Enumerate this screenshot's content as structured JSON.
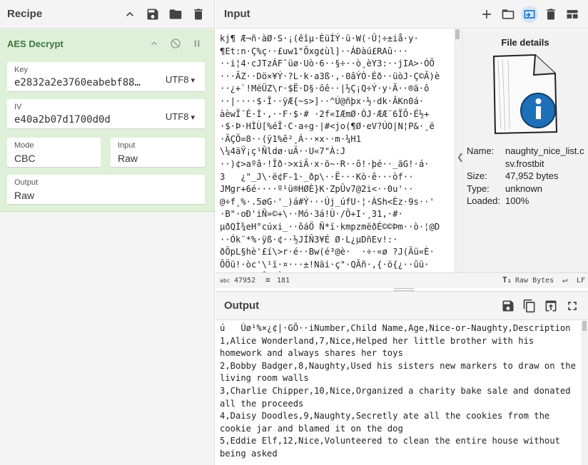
{
  "recipe": {
    "title": "Recipe",
    "operation": {
      "name": "AES Decrypt",
      "key_label": "Key",
      "key_value": "e2832a2e3760eabebf88…",
      "key_format": "UTF8",
      "iv_label": "IV",
      "iv_value": "e40a2b07d1700d0d",
      "iv_format": "UTF8",
      "mode_label": "Mode",
      "mode_value": "CBC",
      "input_label": "Input",
      "input_value": "Raw",
      "output_label": "Output",
      "output_value": "Raw"
    }
  },
  "input": {
    "title": "Input",
    "text": "kj¶ Æ¬ñ·àØ·S·¡(êîµ·ÈüÍÝ·ü·W(·Û¦÷±iå·y·\n¶Et:n·Ç%ç··£uw1\"Õxg¢ùl]··ÁÐàú£RAû···\n··i¦4·cJTzÁF¯üø·Uò·6··§÷··ò¸èY3:··jIA>·ÓÕ\n···ÃZ··Dö×¥Ý·?L·k·a3ß·,·0âÝÒ·Éð··üòJ·Ç©Ã)è\n··¿+`!MëÜZ\\r·$Ë·D§·ôê··|½Ç¡Q÷Ý·y·Ã··®ä·ô\n··|····$·Î··ÿÆ{~s>]··^Ú@ñþx·½·dk·ÂKn0á·\nàèwÏ¨É·Ì·,··F·$·# ·2f«IÆmØ·ÒJ·ÆÆ¨6ÏÕ·É½+\n·$·Þ·HÌÙ[%éÏ·C·a÷g·|#<jo(¶Ø·eV?ÚO|N¦P&·¸ë\n·ÄÇÖ=8··(ÿ1%ê²¸Á··×x··m·¼H1\n\\¼4äŸ¡ç¹Ñldø·uÄ··U«7\"À:J\n··)¢>aºâ·!Ïð·>xiÄ·x·õ~·R··ô!·þé··_ãG!·á·\n3   ¿\"_J\\·ë¢F-1·_ðp\\··Ë···Kò·ê···òf··\nJMgr+6é····º¹ü®HØÈ}K·ZpÛv7@2i<··0u'··\n@÷f¸%·.5øG·'_)á#Ý···Új_úfU·¦·ÁSh<Èz·9s··'\n·B\"·oÐ'iÑ»©+\\··Mó·3á!Ù·/Õ+I·¸31,·#·\nµðQÌ¾eH°cúxi_··ôáÖ Ñ*ï·kmpzmëðÉ©©Þm··ò·¦@D\n··Ók¨*%·ÿß·¢··½JÍÑ3¥É Ø·L¿µDñEv!:·\nðÕpL§hè'£í\\>r·é··Bw(é³@è·  ·÷·«ø ?J(Ãü«È·\nÕÖü!·òc'\\¹ï·¤···±!Näi·ç\"·QÃñ·,{·ö{¿··ûü·\n·ä·····¯Ê··Ò······ ·¯···(¯·©)··+··",
    "details_title": "File details",
    "name_label": "Name:",
    "name_value": "naughty_nice_list.csv.frostbit",
    "size_label": "Size:",
    "size_value": "47,952 bytes",
    "type_label": "Type:",
    "type_value": "unknown",
    "loaded_label": "Loaded:",
    "loaded_value": "100%",
    "status_length": "47952",
    "status_lines": "181",
    "status_raw": "Raw Bytes",
    "status_eol": "LF"
  },
  "output": {
    "title": "Output",
    "text": "ú   Úø¹%×¿¢|·GÕ··iNumber,Child Name,Age,Nice-or-Naughty,Description\n1,Alice Wonderland,7,Nice,Helped her little brother with his homework and always shares her toys\n2,Bobby Badger,8,Naughty,Used his sisters new markers to draw on the living room walls\n3,Charlie Chipper,10,Nice,Organized a charity bake sale and donated all the proceeds\n4,Daisy Doodles,9,Naughty,Secretly ate all the cookies from the cookie jar and blamed it on the dog\n5,Eddie Elf,12,Nice,Volunteered to clean the entire house without being asked"
  }
}
